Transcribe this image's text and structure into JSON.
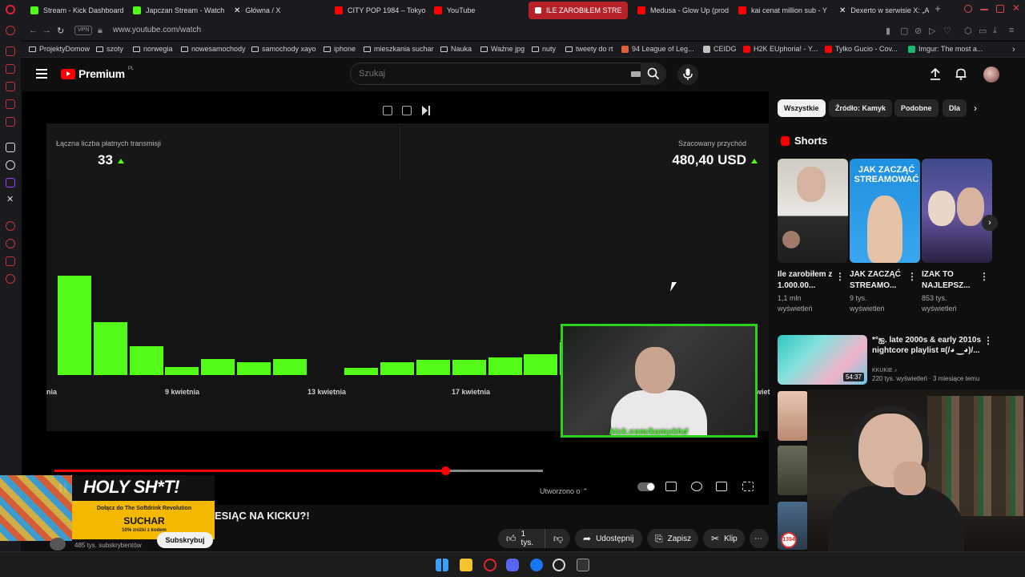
{
  "browser": {
    "tabs": [
      {
        "label": "Stream - Kick Dashboard",
        "icon": "kick-icon",
        "color": "#53fc18"
      },
      {
        "label": "Japczan Stream - Watch",
        "icon": "kick-icon",
        "color": "#53fc18"
      },
      {
        "label": "Główna / X",
        "icon": "x-icon",
        "color": "#ffffff"
      },
      {
        "label": "CITY POP 1984 – Tokyo",
        "icon": "youtube-icon",
        "color": "#ff0000"
      },
      {
        "label": "YouTube",
        "icon": "youtube-icon",
        "color": "#ff0000"
      },
      {
        "label": "ILE ZAROBIŁEM STRE",
        "icon": "youtube-icon",
        "color": "#ff0000",
        "active": true
      },
      {
        "label": "Medusa - Glow Up (prod",
        "icon": "youtube-icon",
        "color": "#ff0000"
      },
      {
        "label": "kai cenat million sub - Y",
        "icon": "youtube-icon",
        "color": "#ff0000"
      },
      {
        "label": "Dexerto w serwisie X: „A",
        "icon": "x-icon",
        "color": "#ffffff"
      }
    ],
    "url": "www.youtube.com/watch",
    "vpn_label": "VPN",
    "bookmarks": [
      {
        "label": "ProjektyDomow",
        "type": "folder"
      },
      {
        "label": "szoty",
        "type": "folder"
      },
      {
        "label": "norwegia",
        "type": "folder"
      },
      {
        "label": "nowesamochody",
        "type": "folder"
      },
      {
        "label": "samochody xayo",
        "type": "folder"
      },
      {
        "label": "iphone",
        "type": "folder"
      },
      {
        "label": "mieszkania suchar",
        "type": "folder"
      },
      {
        "label": "Nauka",
        "type": "folder"
      },
      {
        "label": "Ważne jpg",
        "type": "folder"
      },
      {
        "label": "nuty",
        "type": "folder"
      },
      {
        "label": "tweety do rt",
        "type": "folder"
      },
      {
        "label": "94 League of Leg...",
        "type": "site",
        "color": "#e0603a"
      },
      {
        "label": "CEIDG",
        "type": "site",
        "color": "#c0c0c0"
      },
      {
        "label": "H2K EUphoria! - Y...",
        "type": "site",
        "color": "#ff0000"
      },
      {
        "label": "Tylko Gucio - Cov...",
        "type": "site",
        "color": "#ff0000"
      },
      {
        "label": "Imgur: The most a...",
        "type": "site",
        "color": "#1bb76e"
      }
    ]
  },
  "youtube": {
    "logo_text": "Premium",
    "logo_region": "PL",
    "search_placeholder": "Szukaj",
    "chips": [
      "Wszystkie",
      "Źródło: Kamyk",
      "Podobne",
      "Dla C"
    ],
    "shorts_heading": "Shorts",
    "shorts": [
      {
        "title": "Ile zarobiłem z 1.000.00...",
        "views": "1,1 mln wyświetleń",
        "thumb_text": ""
      },
      {
        "title": "JAK ZACZĄĆ STREAMO...",
        "views": "9 tys. wyświetleń",
        "thumb_text": "JAK ZACZĄĆ STREAMOWAĆ"
      },
      {
        "title": "IZAK TO NAJLEPSZ...",
        "views": "853 tys. wyświetleń",
        "thumb_text": ""
      }
    ],
    "recommended": {
      "title": "*°ஐ. late 2000s & early 2010s nightcore playlist ¤(/◕ ‿◕)/...",
      "channel": "KKUKIE ♪",
      "meta": "220 tys. wyświetleń · 3 miesiące temu",
      "duration": "54:37"
    },
    "video": {
      "title_partial": "ESIĄC NA KICKU?!",
      "subscribers": "485 tys. subskrybentów",
      "subscribe_label": "Subskrybuj",
      "likes": "1 tys.",
      "share_label": "Udostępnij",
      "save_label": "Zapisz",
      "clip_label": "Klip",
      "created_label": "Utworzono o",
      "progress": 0.8
    },
    "ad": {
      "headline": "HOLY SH*T!",
      "description": "Dołącz do The Softdrink Revolution",
      "code": "SUCHAR",
      "discount": "10% zniżki z kodem"
    },
    "badge_count": "1394"
  },
  "kick_dashboard": {
    "stat_left_label": "Łączna liczba płatnych transmisji",
    "stat_left_value": "33",
    "stat_right_label": "Szacowany przychód",
    "stat_right_value": "480,40 USD",
    "webcam_url": "kick.com/kamykhd"
  },
  "chart_data": {
    "type": "bar",
    "categories": [
      "kwietnia",
      "",
      "",
      "9 kwietnia",
      "",
      "",
      "",
      "13 kwietnia",
      "",
      "",
      "",
      "17 kwietnia",
      "",
      "",
      ""
    ],
    "values": [
      100,
      53,
      29,
      8,
      16,
      13,
      16,
      0,
      7,
      13,
      15,
      15,
      18,
      21,
      33
    ],
    "series_color": "#53fc18",
    "xlabels_visible": [
      "nia",
      "9 kwietnia",
      "13 kwietnia",
      "17 kwietnia",
      "wiet"
    ]
  },
  "colors": {
    "kick_green": "#53fc18",
    "youtube_red": "#ff0000",
    "active_tab": "#b72229"
  }
}
